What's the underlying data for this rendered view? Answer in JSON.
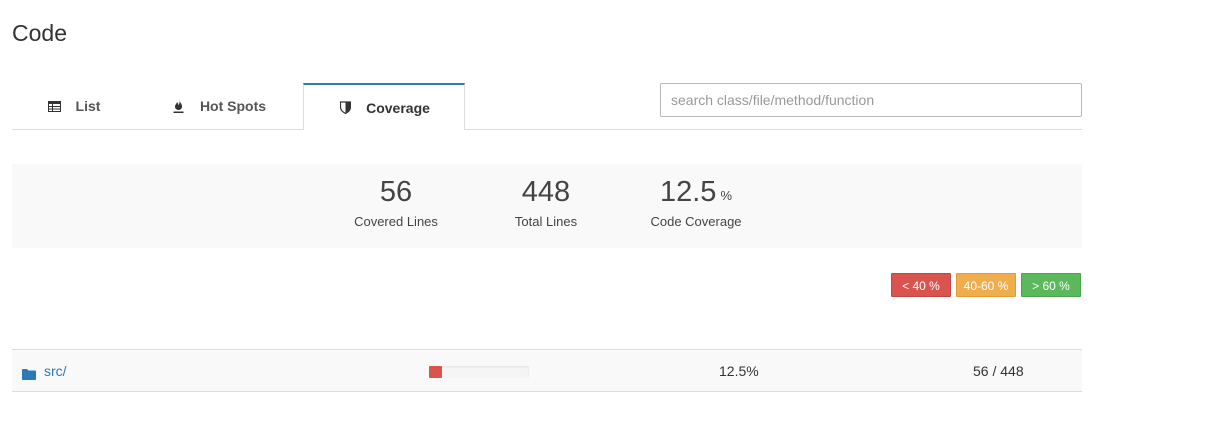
{
  "page": {
    "title": "Code"
  },
  "tabs": [
    {
      "label": "List",
      "icon": "table-icon",
      "active": false
    },
    {
      "label": "Hot Spots",
      "icon": "fire-icon",
      "active": false
    },
    {
      "label": "Coverage",
      "icon": "shield-icon",
      "active": true
    }
  ],
  "search": {
    "placeholder": "search class/file/method/function",
    "value": ""
  },
  "stats": {
    "covered_lines": {
      "value": "56",
      "label": "Covered Lines"
    },
    "total_lines": {
      "value": "448",
      "label": "Total Lines"
    },
    "code_coverage": {
      "value": "12.5",
      "unit": "%",
      "label": "Code Coverage"
    }
  },
  "legend": [
    {
      "label": "< 40 %",
      "color": "#d9534f"
    },
    {
      "label": "40-60 %",
      "color": "#f0ad4e"
    },
    {
      "label": "> 60 %",
      "color": "#5cb85c"
    }
  ],
  "rows": [
    {
      "name": "src/",
      "icon": "folder-icon",
      "coverage_fraction": 0.125,
      "coverage_text": "12.5%",
      "lines_text": "56 / 448"
    }
  ],
  "colors": {
    "accent": "#2a7ab7",
    "low": "#d9534f",
    "medium": "#f0ad4e",
    "high": "#5cb85c"
  }
}
